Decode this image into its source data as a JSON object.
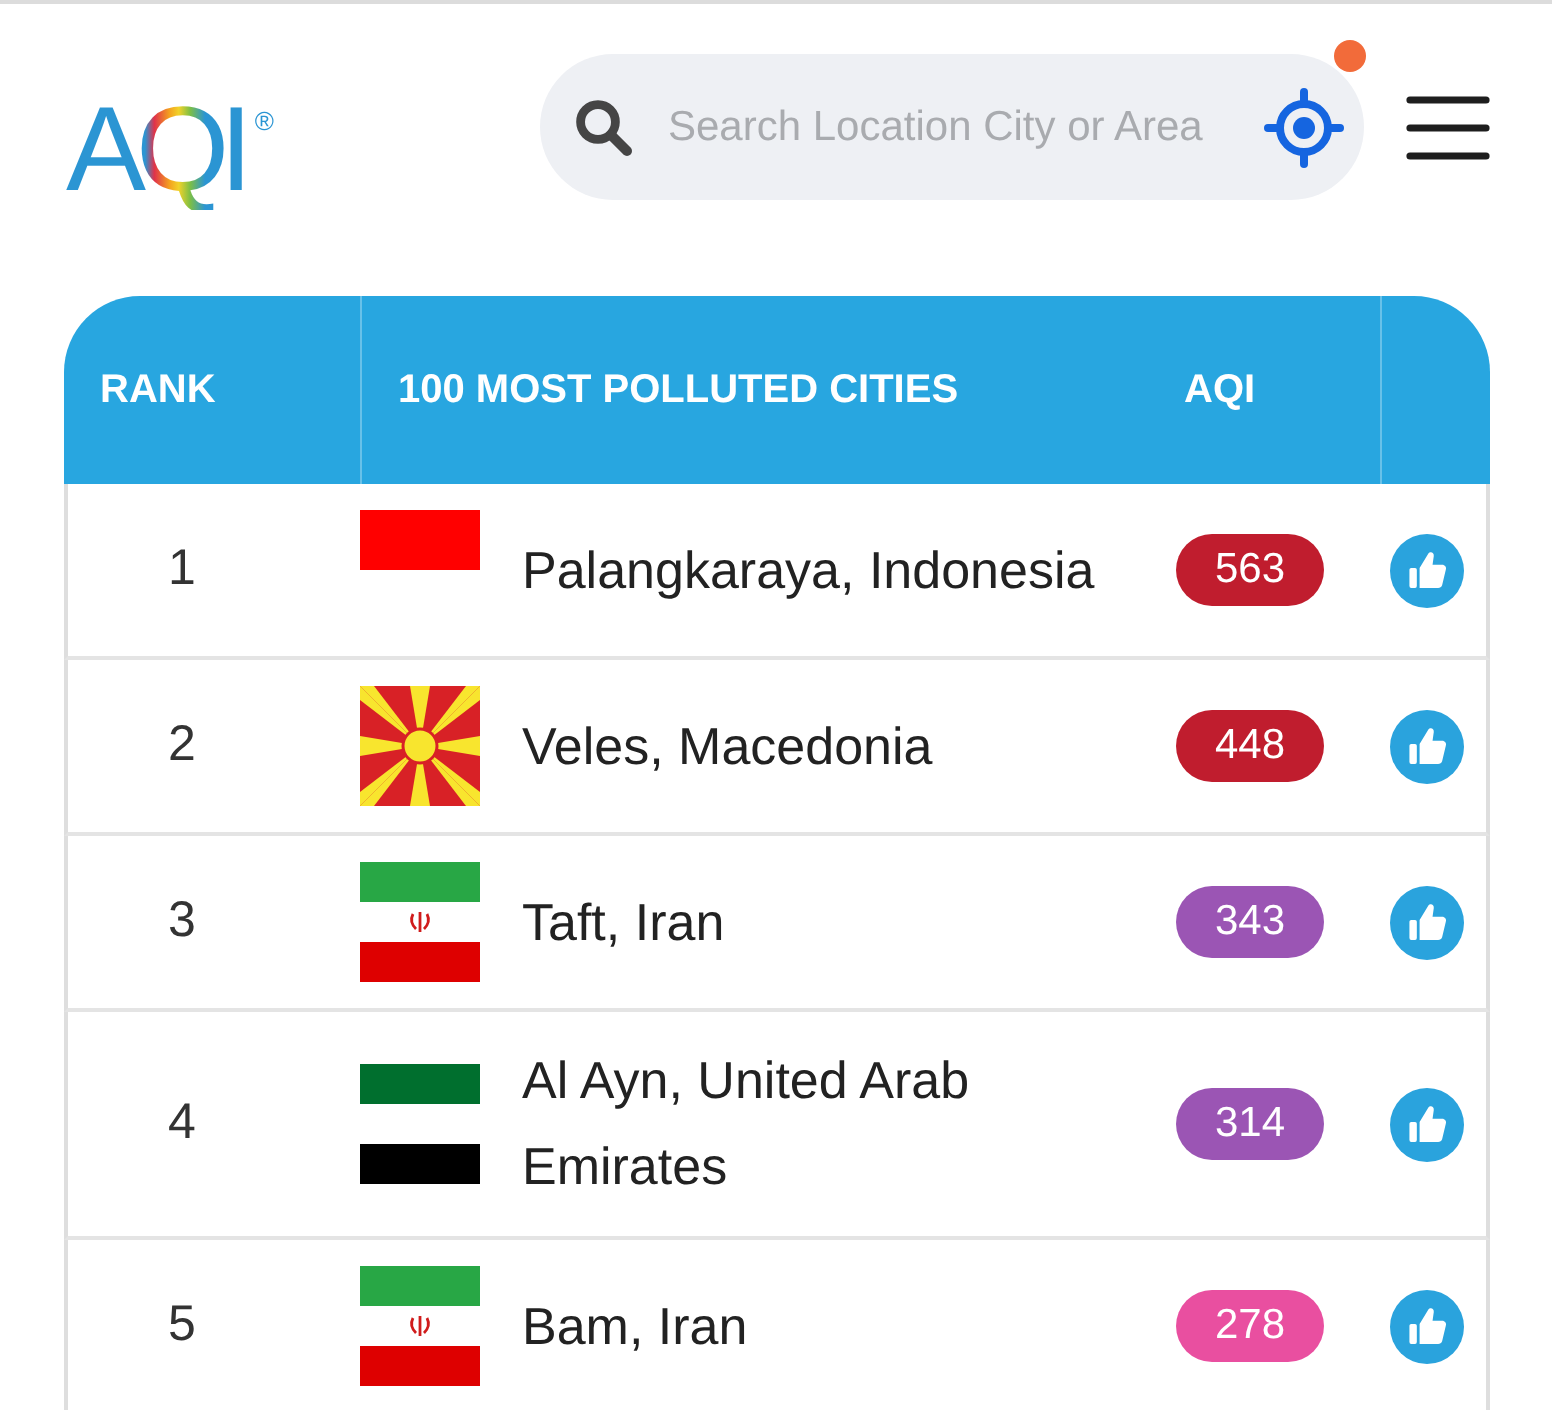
{
  "header": {
    "logo": {
      "text": "AQI",
      "mark": "®"
    },
    "search": {
      "placeholder": "Search Location City or Area"
    }
  },
  "table": {
    "columns": [
      "RANK",
      "100 MOST POLLUTED CITIES",
      "AQI"
    ],
    "rows": [
      {
        "rank": "1",
        "flag": {
          "kind": "indonesia"
        },
        "city": "Palangkaraya, Indonesia",
        "aqi": "563",
        "color": "#c01d2e"
      },
      {
        "rank": "2",
        "flag": {
          "kind": "macedonia"
        },
        "city": "Veles, Macedonia",
        "aqi": "448",
        "color": "#c01d2e"
      },
      {
        "rank": "3",
        "flag": {
          "kind": "iran"
        },
        "city": "Taft, Iran",
        "aqi": "343",
        "color": "#9b55b4"
      },
      {
        "rank": "4",
        "flag": {
          "kind": "uae"
        },
        "city": "Al Ayn, United Arab Emirates",
        "aqi": "314",
        "color": "#9b55b4"
      },
      {
        "rank": "5",
        "flag": {
          "kind": "iran"
        },
        "city": "Bam, Iran",
        "aqi": "278",
        "color": "#e94fa0"
      }
    ]
  }
}
